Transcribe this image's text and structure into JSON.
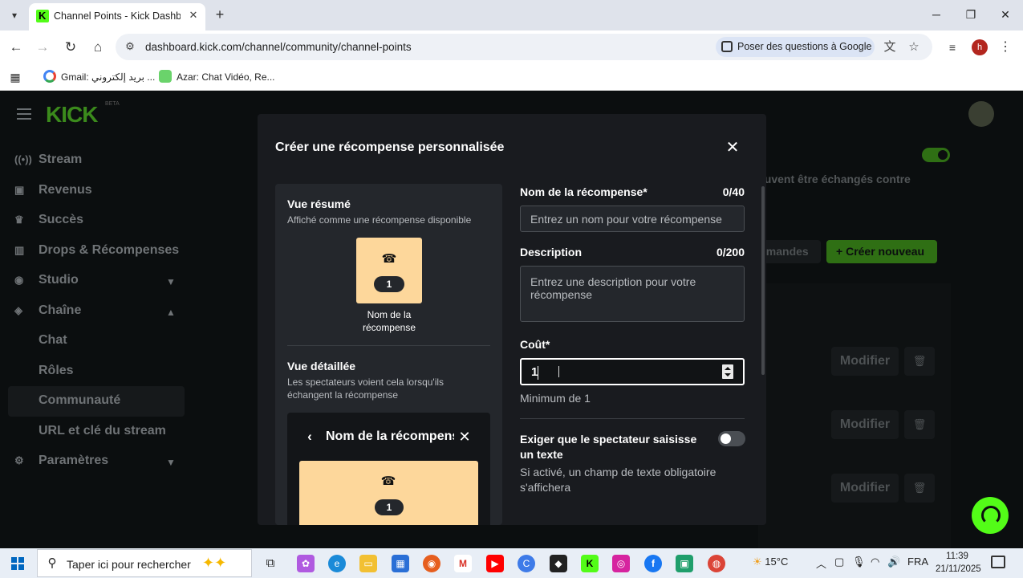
{
  "browser": {
    "tab_title": "Channel Points - Kick Dashboard",
    "url": "dashboard.kick.com/channel/community/channel-points",
    "ask_google": "Poser des questions à Google",
    "profile_initial": "h",
    "bookmarks": [
      {
        "label": "Gmail: بريد إلكتروني ...",
        "icon": "google-icon"
      },
      {
        "label": "Azar: Chat Vidéo, Re...",
        "icon": "azar-icon"
      }
    ]
  },
  "sidebar": {
    "items": [
      {
        "label": "Stream",
        "icon": "broadcast-icon"
      },
      {
        "label": "Revenus",
        "icon": "wallet-icon"
      },
      {
        "label": "Succès",
        "icon": "trophy-icon"
      },
      {
        "label": "Drops & Récompenses",
        "icon": "gift-icon"
      },
      {
        "label": "Studio",
        "icon": "camera-icon"
      },
      {
        "label": "Chaîne",
        "icon": "channel-icon"
      }
    ],
    "subitems": [
      "Chat",
      "Rôles",
      "Communauté",
      "URL et clé du stream"
    ],
    "settings": "Paramètres",
    "active": "Communauté"
  },
  "background": {
    "description_fragment": "euvent être échangés contre",
    "demandes_label": "emandes",
    "create_label": "Créer nouveau",
    "modify_label": "Modifier"
  },
  "modal": {
    "title": "Créer une récompense personnalisée",
    "preview": {
      "summary_title": "Vue résumé",
      "summary_sub": "Affiché comme une récompense disponible",
      "card_cost": "1",
      "card_caption": "Nom de la récompense",
      "detail_title": "Vue détaillée",
      "detail_sub": "Les spectateurs voient cela lorsqu'ils échangent la récompense",
      "detail_header": "Nom de la récompense"
    },
    "form": {
      "name_label": "Nom de la récompense*",
      "name_count": "0/40",
      "name_placeholder": "Entrez un nom pour votre récompense",
      "desc_label": "Description",
      "desc_count": "0/200",
      "desc_placeholder": "Entrez une description pour votre récompense",
      "cost_label": "Coût*",
      "cost_value": "1",
      "cost_hint": "Minimum de 1",
      "require_text_label": "Exiger que le spectateur saisisse un texte",
      "require_text_sub": "Si activé, un champ de texte obligatoire s'affichera",
      "require_text_enabled": false
    }
  },
  "taskbar": {
    "search_placeholder": "Taper ici pour rechercher",
    "weather": "15°C",
    "language": "FRA",
    "time": "11:39",
    "date": "21/11/2025"
  },
  "colors": {
    "kick_green": "#53fc18",
    "modal_bg": "#191b1f",
    "card_bg": "#fdd79b"
  }
}
